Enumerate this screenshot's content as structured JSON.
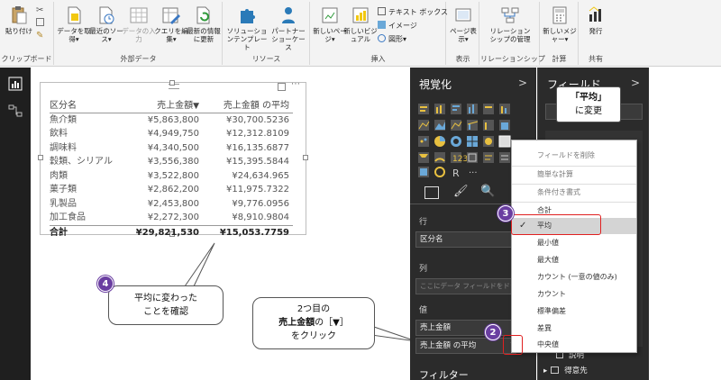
{
  "ribbon": {
    "groups": [
      {
        "label": "クリップボード",
        "buttons": [
          {
            "label": "貼り付け"
          }
        ]
      },
      {
        "label": "外部データ",
        "buttons": [
          {
            "label": "データを取得▾"
          },
          {
            "label": "最近のソース▾"
          },
          {
            "label": "データの入力"
          },
          {
            "label": "クエリを編集▾"
          },
          {
            "label": "最新の情報に更新"
          }
        ]
      },
      {
        "label": "リソース",
        "buttons": [
          {
            "label": "ソリューションテンプレート"
          },
          {
            "label": "パートナーショーケース"
          }
        ]
      },
      {
        "label": "挿入",
        "buttons": [
          {
            "label": "新しいページ▾"
          },
          {
            "label": "新しいビジュアル"
          }
        ],
        "small": [
          "テキスト ボックス",
          "イメージ",
          "図形▾"
        ]
      },
      {
        "label": "表示",
        "buttons": [
          {
            "label": "ページ表示▾"
          }
        ]
      },
      {
        "label": "リレーションシップ",
        "buttons": [
          {
            "label": "リレーションシップの管理"
          }
        ]
      },
      {
        "label": "計算",
        "buttons": [
          {
            "label": "新しいメジャー▾"
          }
        ]
      },
      {
        "label": "共有",
        "buttons": [
          {
            "label": "発行"
          }
        ]
      }
    ]
  },
  "table": {
    "headers": [
      "区分名",
      "売上金額",
      "売上金額 の平均"
    ],
    "rows": [
      [
        "魚介類",
        "¥5,863,800",
        "¥30,700.5236"
      ],
      [
        "飲料",
        "¥4,949,750",
        "¥12,312.8109"
      ],
      [
        "調味料",
        "¥4,340,500",
        "¥16,135.6877"
      ],
      [
        "穀類、シリアル",
        "¥3,556,380",
        "¥15,395.5844"
      ],
      [
        "肉類",
        "¥3,522,800",
        "¥24,634.965"
      ],
      [
        "菓子類",
        "¥2,862,200",
        "¥11,975.7322"
      ],
      [
        "乳製品",
        "¥2,453,800",
        "¥9,776.0956"
      ],
      [
        "加工食品",
        "¥2,272,300",
        "¥8,910.9804"
      ]
    ],
    "total": [
      "合計",
      "¥29,821,530",
      "¥15,053.7759"
    ],
    "sort_glyph": "▼"
  },
  "callouts": {
    "c4_num": "4",
    "c4_text1": "平均に変わった",
    "c4_text2": "ことを確認",
    "c2_num": "2",
    "c2_text1": "2つ目の",
    "c2_text2_bold": "売上金額",
    "c2_text2_rest": "の［▼］",
    "c2_text3": "をクリック",
    "c3_num": "3",
    "c3_text1": "「平均」",
    "c3_text2": "に変更"
  },
  "viz_pane": {
    "title": "視覚化",
    "arrow": ">",
    "rows_label": "行",
    "rows_value": "区分名",
    "cols_label": "列",
    "cols_placeholder": "ここにデータ フィールドをドラッグします",
    "values_label": "値",
    "value1": "売上金額",
    "value2": "売上金額 の平均",
    "filters_label": "フィルター"
  },
  "fields_pane": {
    "title": "フィールド",
    "arrow": ">",
    "item_desc": "説明",
    "item_table": "得意先"
  },
  "menu": {
    "items": [
      "フィールドを削除",
      "簡単な計算",
      "条件付き書式",
      "合計",
      "平均",
      "最小値",
      "最大値",
      "カウント (一意の値のみ)",
      "カウント",
      "標準偏差",
      "差異",
      "中央値"
    ],
    "selected_index": 4,
    "check": "✓"
  },
  "colors": {
    "accent_purple": "#6a3ea1",
    "highlight_red": "#e02020",
    "pane_dark": "#2b2b2b"
  }
}
